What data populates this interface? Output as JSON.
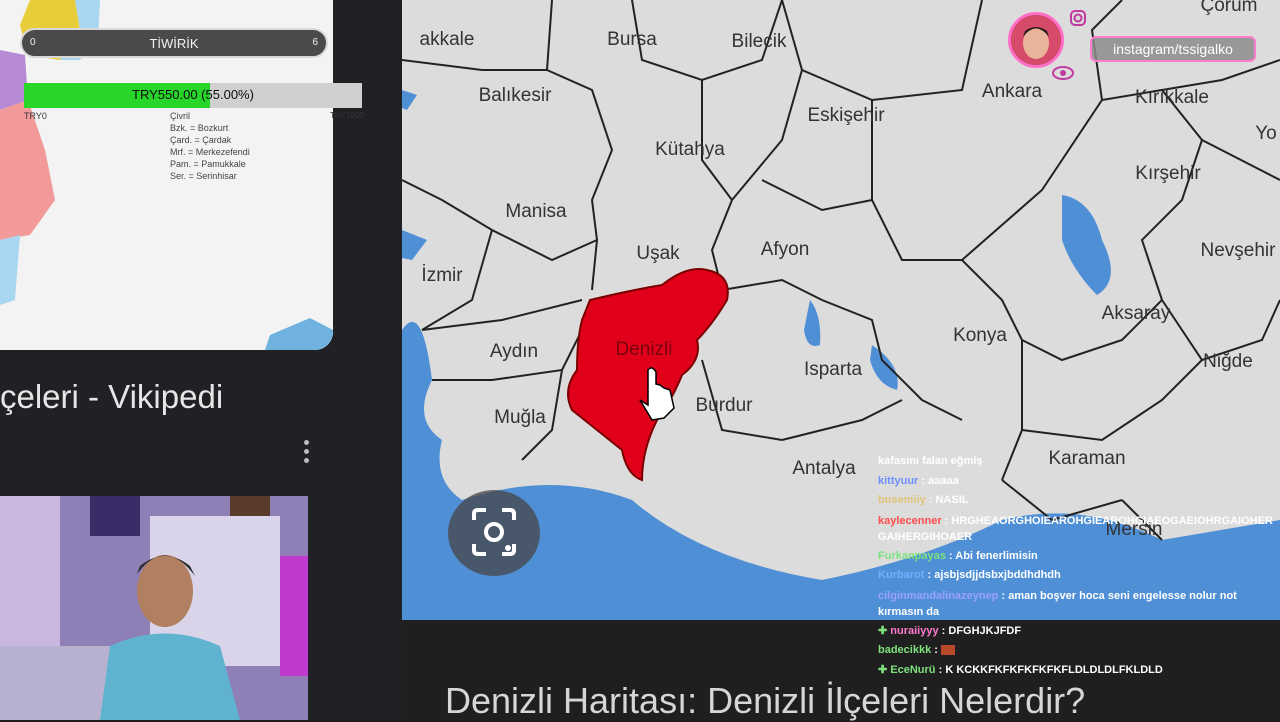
{
  "goal": {
    "label": "TİWİRİK",
    "min": "0",
    "max": "6"
  },
  "donation": {
    "text": "TRY550.00 (55.00%)",
    "progress": 0.55,
    "min": "TRY0",
    "max": "TRY1000",
    "color": "#28d629"
  },
  "map_legend": [
    "Çivril",
    "Bzk. = Bozkurt",
    "Çard. = Çardak",
    "Mrf. = Merkezefendi",
    "Pam. = Pamukkale",
    "Ser. = Serinhisar"
  ],
  "wiki": {
    "title": "çeleri - Vikipedi"
  },
  "map": {
    "highlight_color": "#e0001a",
    "provinces": [
      "akkale",
      "Bursa",
      "Bilecik",
      "Çorum",
      "Balıkesir",
      "Eskişehir",
      "Ankara",
      "Kırıkkale",
      "Kütahya",
      "Yo",
      "Manisa",
      "Kırşehir",
      "Uşak",
      "Afyon",
      "İzmir",
      "Nevşehir",
      "Aksaray",
      "Denizli",
      "Konya",
      "Aydın",
      "Isparta",
      "Niğde",
      "Burdur",
      "Muğla",
      "Antalya",
      "Karaman",
      "Mersin"
    ]
  },
  "caption": "Denizli Haritası: Denizli İlçeleri Nelerdir?",
  "overlay": {
    "instagram": "instagram/tssigalko"
  },
  "chat": [
    {
      "user": "",
      "text": "kafasını falan eğmiş",
      "color": "#ffffff"
    },
    {
      "user": "kittyuur",
      "text": "aaaaa",
      "color": "#6f8fff"
    },
    {
      "user": "busemiiy",
      "text": "NASIL",
      "color": "#e0c47a"
    },
    {
      "user": "kaylecenner",
      "text": "HRGHEAORGHOIEAROHGIEAROHGIAEOGAEIOHRGAIOHERGAIHERGIHOAER",
      "color": "#ff4b4b"
    },
    {
      "user": "Furkanpayas",
      "text": "Abi fenerlimisin",
      "color": "#7de27d"
    },
    {
      "user": "Kurbarot",
      "text": "ajsbjsdjjdsbxjbddhdhdh",
      "color": "#6fb0ff"
    },
    {
      "user": "cilginmandalinazeynep",
      "text": "aman boşver hoca seni engelesse nolur not kırmasın da",
      "color": "#9aa0ff"
    },
    {
      "user": "nuraiiyyy",
      "text": "DFGHJKJFDF",
      "color": "#ff7ad0"
    },
    {
      "user": "badecikkk",
      "text": "",
      "color": "#7de27d"
    },
    {
      "user": "EceNurü",
      "text": "K KCKKFKFKFKFKFKFLDLDLDLFKLDLD",
      "color": "#7de27d"
    }
  ]
}
